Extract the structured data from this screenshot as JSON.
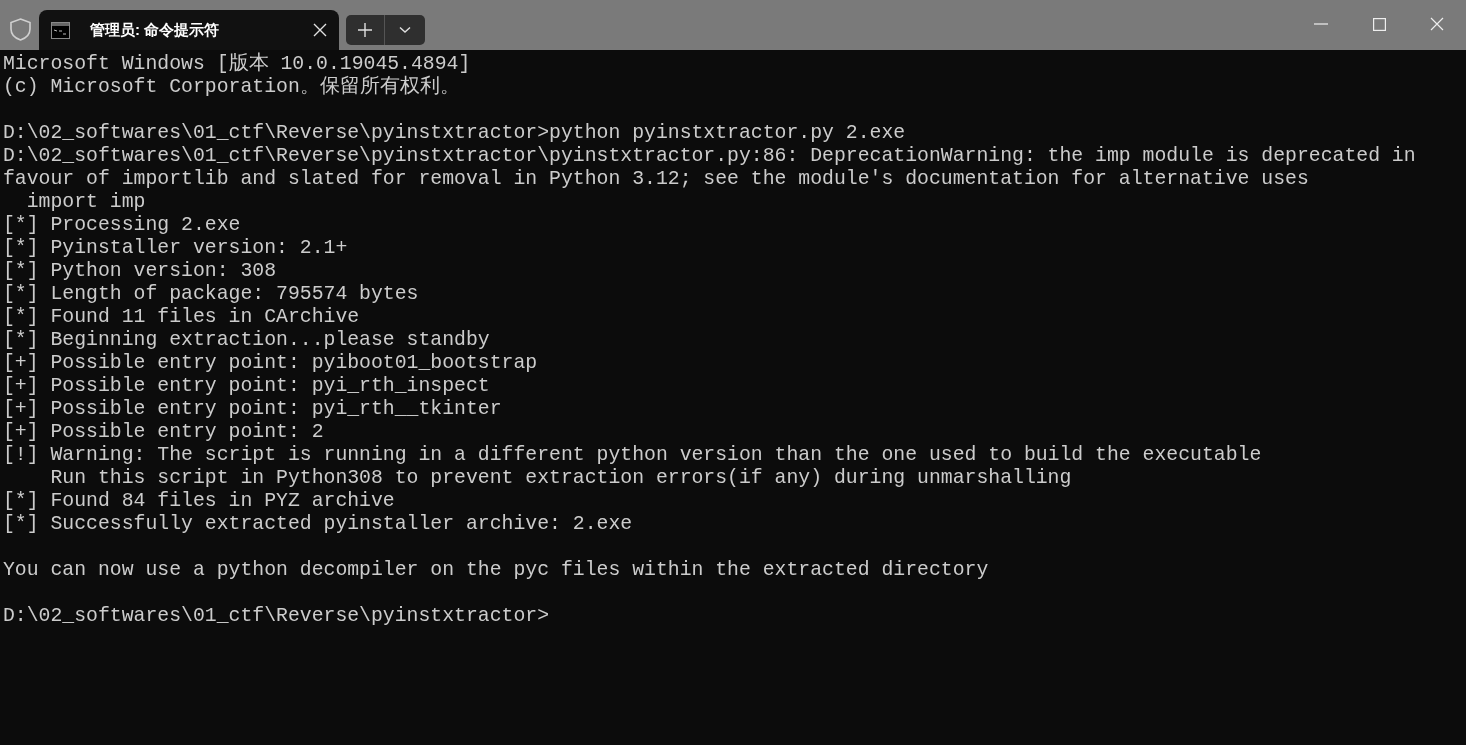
{
  "window": {
    "tab_title": "管理员: 命令提示符",
    "tab_selected": true
  },
  "terminal": {
    "blocks": [
      [
        "Microsoft Windows [版本 10.0.19045.4894]",
        "(c) Microsoft Corporation。保留所有权利。"
      ],
      [
        "D:\\02_softwares\\01_ctf\\Reverse\\pyinstxtractor>python pyinstxtractor.py 2.exe",
        "D:\\02_softwares\\01_ctf\\Reverse\\pyinstxtractor\\pyinstxtractor.py:86: DeprecationWarning: the imp module is deprecated in",
        "favour of importlib and slated for removal in Python 3.12; see the module's documentation for alternative uses",
        "  import imp",
        "[*] Processing 2.exe",
        "[*] Pyinstaller version: 2.1+",
        "[*] Python version: 308",
        "[*] Length of package: 795574 bytes",
        "[*] Found 11 files in CArchive",
        "[*] Beginning extraction...please standby",
        "[+] Possible entry point: pyiboot01_bootstrap",
        "[+] Possible entry point: pyi_rth_inspect",
        "[+] Possible entry point: pyi_rth__tkinter",
        "[+] Possible entry point: 2",
        "[!] Warning: The script is running in a different python version than the one used to build the executable",
        "    Run this script in Python308 to prevent extraction errors(if any) during unmarshalling",
        "[*] Found 84 files in PYZ archive",
        "[*] Successfully extracted pyinstaller archive: 2.exe"
      ],
      [
        "You can now use a python decompiler on the pyc files within the extracted directory"
      ],
      [
        "D:\\02_softwares\\01_ctf\\Reverse\\pyinstxtractor>"
      ]
    ]
  }
}
